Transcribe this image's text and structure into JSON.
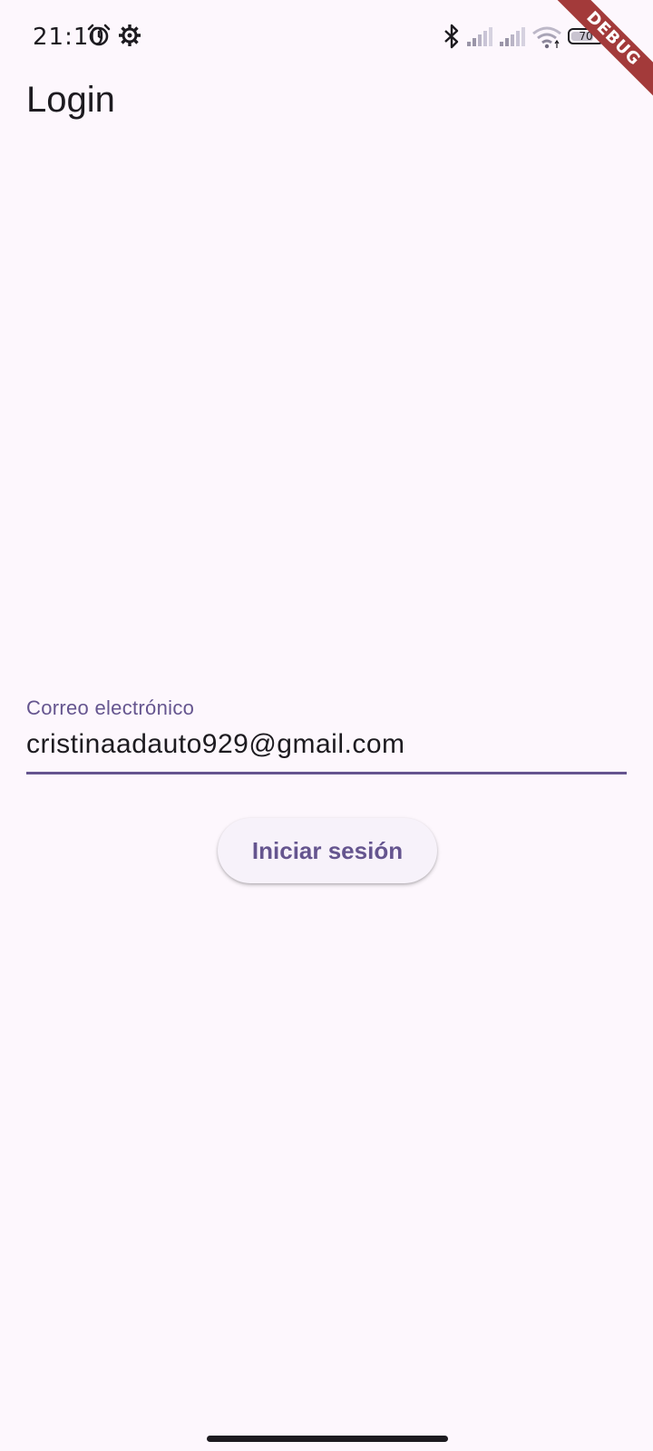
{
  "status_bar": {
    "time": "21:10",
    "battery_level": 70,
    "battery_text": "70",
    "icons": [
      "alarm-icon",
      "gear-icon",
      "bluetooth-icon",
      "signal-icon",
      "signal-icon",
      "wifi-icon",
      "battery-icon",
      "charging-bolt-icon"
    ]
  },
  "debug_banner": {
    "label": "DEBUG",
    "color": "#a33a3a"
  },
  "app_bar": {
    "title": "Login"
  },
  "email_field": {
    "label": "Correo electrónico",
    "value": "cristinaadauto929@gmail.com"
  },
  "login_button": {
    "label": "Iniciar sesión"
  },
  "colors": {
    "background": "#fdf7fd",
    "primary": "#65558f",
    "text": "#1d1b20",
    "button_bg": "#f7f2fa"
  }
}
